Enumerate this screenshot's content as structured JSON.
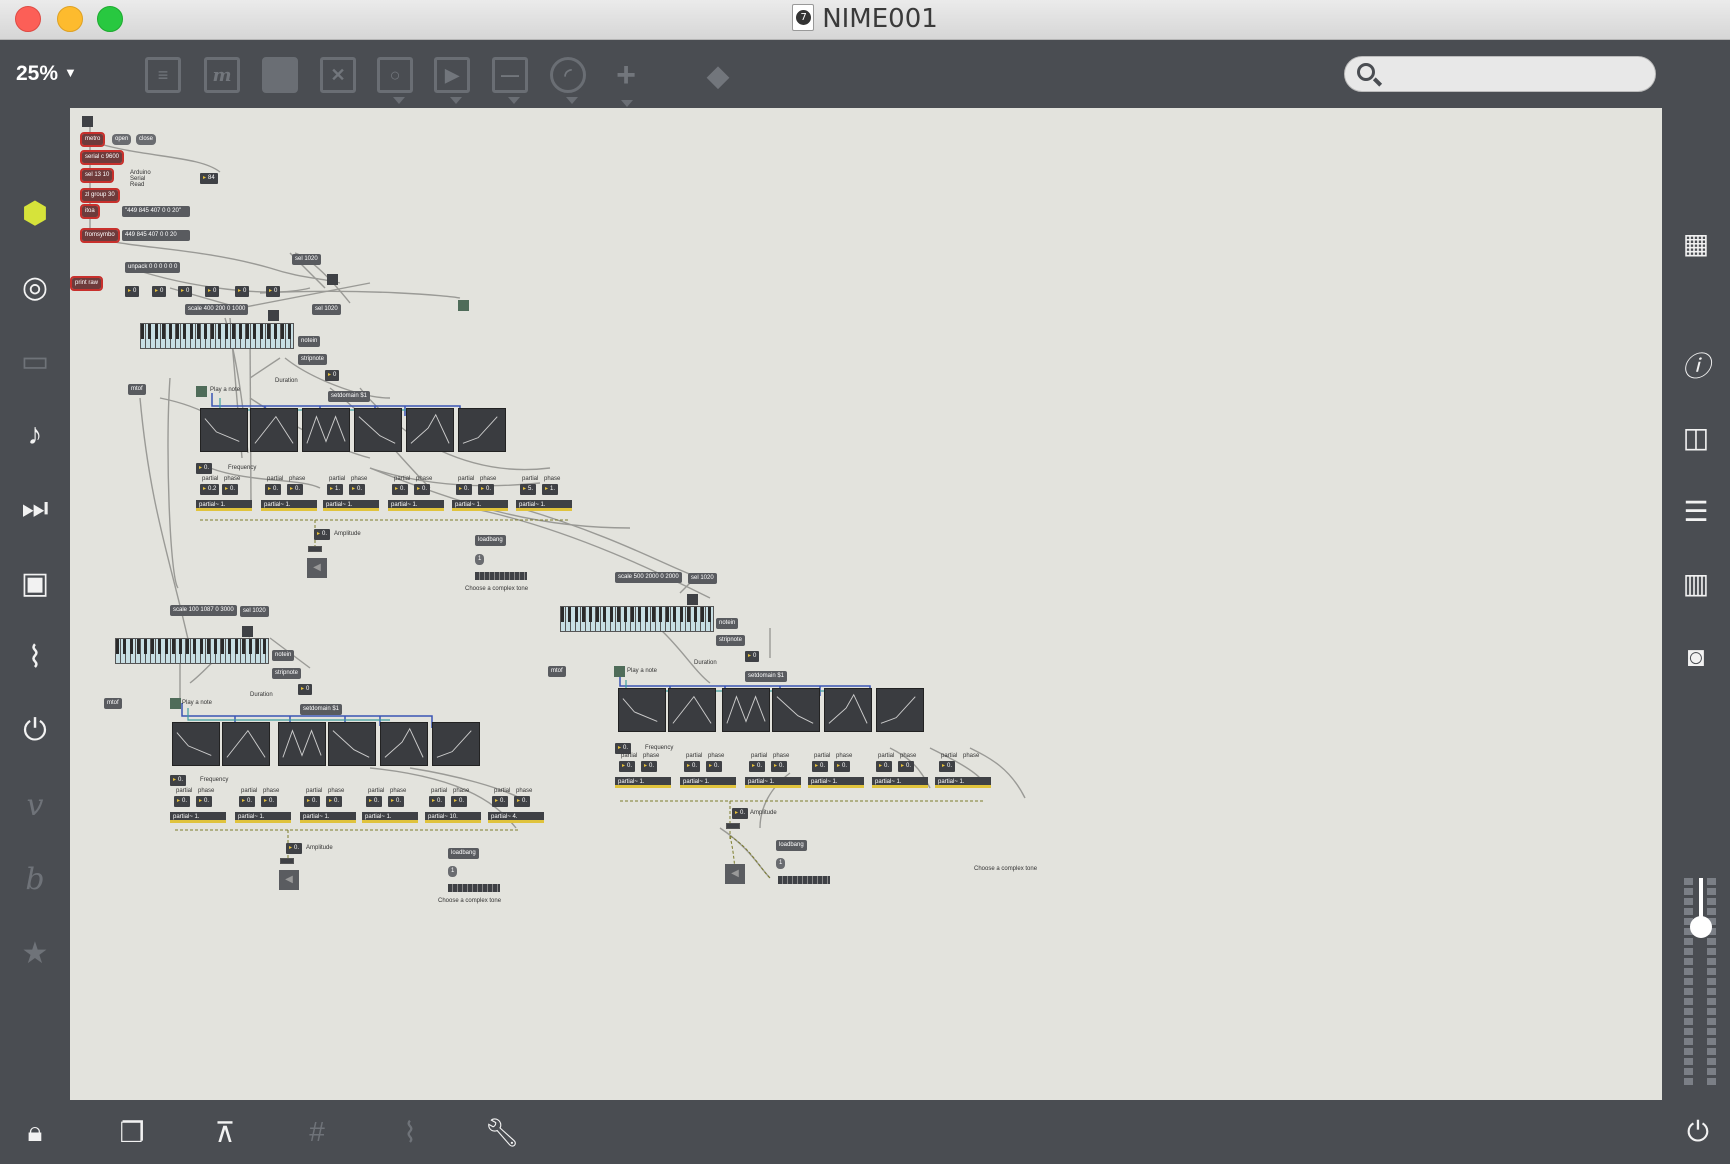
{
  "window": {
    "title": "NIME001"
  },
  "toolbar": {
    "zoom": "25%",
    "search_placeholder": "",
    "tools": [
      "object-box",
      "message-box",
      "comment",
      "button",
      "toggle",
      "play",
      "slider",
      "dial",
      "add",
      "paint"
    ]
  },
  "left_sidebar": [
    "cube-icon",
    "target-icon",
    "panel-icon",
    "music-note-icon",
    "media-icon",
    "image-icon",
    "paperclip-icon",
    "plug-icon",
    "v-icon",
    "b-icon",
    "star-icon"
  ],
  "right_sidebar": [
    "grid-icon",
    "info-icon",
    "split-view-icon",
    "list-icon",
    "book-icon",
    "camera-icon"
  ],
  "bottom_bar": [
    "lock-icon",
    "windows-icon",
    "presentation-icon",
    "grid-toggle-icon",
    "snap-icon",
    "wrench-icon",
    "power-icon"
  ],
  "colors": {
    "accent": "#e7c13a",
    "error": "#c8302c",
    "canvas": "#e3e3dd",
    "chrome": "#4a4d52"
  },
  "patch": {
    "header": {
      "metro": "metro",
      "open": "open",
      "close": "close",
      "serial": "serial c 9600",
      "sel": "sel 13 10",
      "zlgroup": "zl group 30",
      "itoa": "itoa",
      "fromsymbol": "fromsymbo",
      "print": "print raw",
      "comment_lines": [
        "Arduino",
        "Serial",
        "Read"
      ],
      "num84": "84",
      "msg1": "\"449 845 407 0 0 20\"",
      "msg2": "449 845 407 0 0 20",
      "unpack": "unpack 0 0 0 0 0 0",
      "num_outs": [
        "0",
        "0",
        "0",
        "0",
        "0",
        "0"
      ],
      "sel1020a": "sel 1020",
      "sel1020b": "sel 1020",
      "scale1": "scale 400 200 0 1000"
    },
    "voice1": {
      "notein": "notein",
      "stripnote": "stripnote",
      "mtof": "mtof",
      "play": "Play a note",
      "duration": "Duration",
      "dur_num": "0",
      "setdomain": "setdomain $1",
      "freq_num": "0.",
      "freq_label": "Frequency",
      "partial_label": "partial",
      "phase_label": "phase",
      "partials": [
        {
          "p": "0.2",
          "ph": "0."
        },
        {
          "p": "0.",
          "ph": "0."
        },
        {
          "p": "1.",
          "ph": "0."
        },
        {
          "p": "0.",
          "ph": "0."
        },
        {
          "p": "0.",
          "ph": "0."
        },
        {
          "p": "5.",
          "ph": "1."
        }
      ],
      "partial_box": "partial~ 1.",
      "amp_num": "0.",
      "amp_label": "Amplitude",
      "loadbang": "loadbang",
      "one": "1",
      "choose": "Choose a complex tone"
    },
    "voice2": {
      "scale": "scale 100 1087 0 3000",
      "sel": "sel 1020",
      "notein": "notein",
      "stripnote": "stripnote",
      "mtof": "mtof",
      "play": "Play a note",
      "duration": "Duration",
      "dur_num": "0",
      "setdomain": "setdomain $1",
      "freq_num": "0.",
      "freq_label": "Frequency",
      "partials": [
        {
          "p": "0.",
          "ph": "0."
        },
        {
          "p": "0.",
          "ph": "0."
        },
        {
          "p": "0.",
          "ph": "0."
        },
        {
          "p": "0.",
          "ph": "0."
        },
        {
          "p": "0.",
          "ph": "0."
        },
        {
          "p": "0.",
          "ph": "0."
        }
      ],
      "partial_boxes": [
        "partial~ 1.",
        "partial~ 1.",
        "partial~ 1.",
        "partial~ 1.",
        "partial~ 10.",
        "partial~ 4."
      ],
      "amp_num": "0.",
      "amp_label": "Amplitude",
      "loadbang": "loadbang",
      "one": "1",
      "choose": "Choose a complex tone"
    },
    "voice3": {
      "scale": "scale 500 2000 0 2000",
      "sel": "sel 1020",
      "notein": "notein",
      "stripnote": "stripnote",
      "mtof": "mtof",
      "play": "Play a note",
      "duration": "Duration",
      "dur_num": "0",
      "setdomain": "setdomain $1",
      "freq_num": "0.",
      "freq_label": "Frequency",
      "partials": [
        {
          "p": "0.",
          "ph": "0."
        },
        {
          "p": "0.",
          "ph": "0."
        },
        {
          "p": "0.",
          "ph": "0."
        },
        {
          "p": "0.",
          "ph": "0."
        },
        {
          "p": "0.",
          "ph": "0."
        },
        {
          "p": "0.",
          "ph": ""
        }
      ],
      "partial_box": "partial~ 1.",
      "amp_num": "0.",
      "amp_label": "Amplitude",
      "loadbang": "loadbang",
      "one": "1",
      "choose": "Choose a complex tone"
    }
  }
}
